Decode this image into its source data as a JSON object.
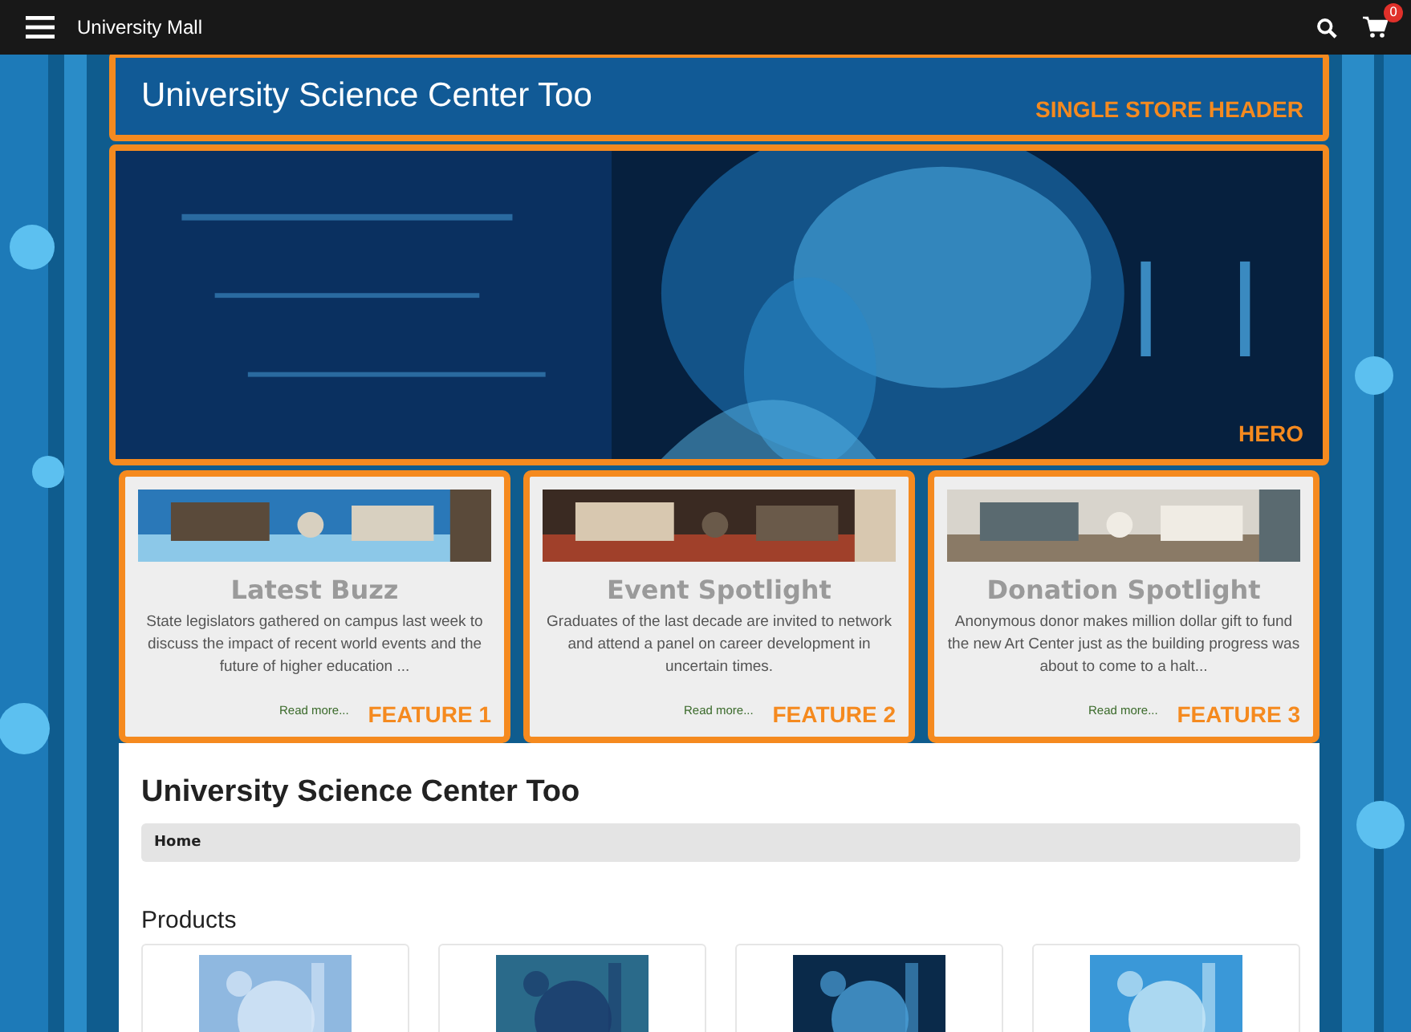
{
  "top_bar": {
    "title": "University Mall",
    "cart_count": "0"
  },
  "store_header": {
    "title": "University Science Center Too",
    "annotation": "SINGLE STORE HEADER"
  },
  "hero": {
    "annotation": "HERO"
  },
  "features": [
    {
      "title": "Latest Buzz",
      "text": "State legislators gathered on campus last week to discuss the impact of recent world events and the future of higher education ...",
      "link": "Read more...",
      "annotation": "FEATURE 1"
    },
    {
      "title": "Event Spotlight",
      "text": "Graduates of the last decade are invited to network and attend a panel on career development in uncertain times.",
      "link": "Read more...",
      "annotation": "FEATURE 2"
    },
    {
      "title": "Donation Spotlight",
      "text": "Anonymous donor makes million dollar gift to fund the new Art Center just as the building progress was about to come to a halt...",
      "link": "Read more...",
      "annotation": "FEATURE 3"
    }
  ],
  "page_title": "University Science Center Too",
  "breadcrumb": [
    "Home"
  ],
  "products": {
    "heading": "Products"
  }
}
